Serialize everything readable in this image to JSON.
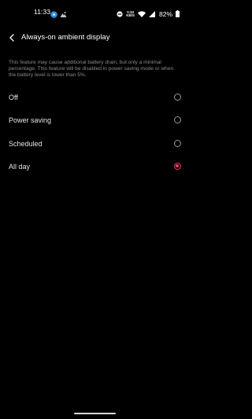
{
  "status_bar": {
    "time": "11:33",
    "net_speed_value": "0.33",
    "net_speed_unit": "KB/S",
    "battery_percent": "82%"
  },
  "header": {
    "title": "Always-on ambient display"
  },
  "description": "This feature may cause additional battery drain, but only a minimal percentage. This feature will be disabled in power saving mode or when the battery level is lower than 5%.",
  "options": [
    {
      "label": "Off",
      "selected": false
    },
    {
      "label": "Power saving",
      "selected": false
    },
    {
      "label": "Scheduled",
      "selected": false
    },
    {
      "label": "All day",
      "selected": true
    }
  ],
  "colors": {
    "background": "#000000",
    "accent": "#e4405e",
    "radio_border": "#9a9a9a",
    "text_primary": "#e6e6e6",
    "text_secondary": "#8a8a8a"
  },
  "icons": {
    "back": "chevron-left-icon",
    "status_app_1": "blue-circle-app-icon",
    "status_app_2": "mountain-image-icon",
    "status_mode": "do-not-disturb-icon",
    "status_wifi": "wifi-icon",
    "status_signal": "cell-signal-icon",
    "status_battery": "battery-icon"
  }
}
